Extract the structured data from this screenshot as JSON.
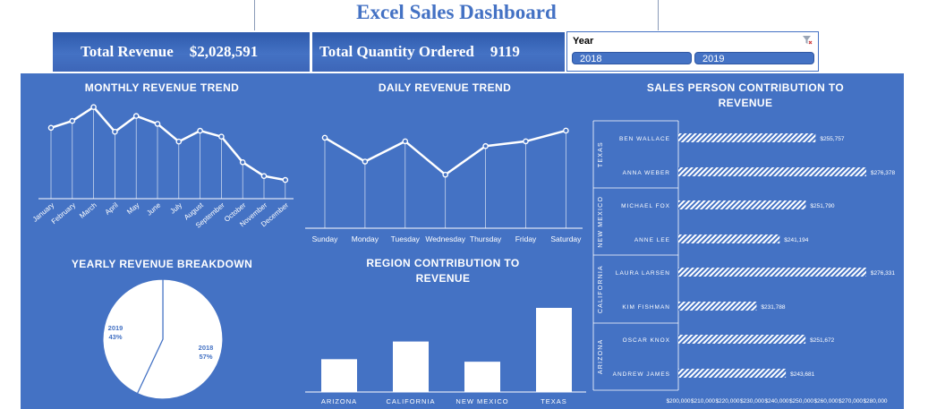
{
  "dashboard": {
    "title": "Excel Sales Dashboard",
    "kpis": {
      "revenue_label": "Total Revenue",
      "revenue_value": "$2,028,591",
      "quantity_label": "Total Quantity Ordered",
      "quantity_value": "9119"
    },
    "slicer": {
      "title": "Year",
      "options": [
        "2018",
        "2019"
      ],
      "clear_icon": "filter-clear-icon"
    },
    "colors": {
      "panel": "#4472c4",
      "title": "#4472c4",
      "marks": "#ffffff"
    }
  },
  "chart_data": [
    {
      "type": "line",
      "title": "MONTHLY REVENUE TREND",
      "categories": [
        "January",
        "February",
        "March",
        "April",
        "May",
        "June",
        "July",
        "August",
        "September",
        "October",
        "November",
        "December"
      ],
      "values": [
        0.72,
        0.79,
        0.93,
        0.68,
        0.84,
        0.76,
        0.58,
        0.69,
        0.63,
        0.37,
        0.23,
        0.19
      ],
      "value_scale": "relative (no axis printed)",
      "markers": true,
      "drop_lines": true
    },
    {
      "type": "line",
      "title": "DAILY REVENUE TREND",
      "categories": [
        "Sunday",
        "Monday",
        "Tuesday",
        "Wednesday",
        "Thursday",
        "Friday",
        "Saturday"
      ],
      "values": [
        0.76,
        0.56,
        0.73,
        0.45,
        0.69,
        0.73,
        0.82
      ],
      "value_scale": "relative (no axis printed)",
      "markers": true,
      "drop_lines": true
    },
    {
      "type": "pie",
      "title": "YEARLY REVENUE BREAKDOWN",
      "slices": [
        {
          "label": "2018",
          "pct_label": "57%",
          "value": 57
        },
        {
          "label": "2019",
          "pct_label": "43%",
          "value": 43
        }
      ]
    },
    {
      "type": "bar",
      "title": "REGION CONTRIBUTION TO REVENUE",
      "categories": [
        "ARIZONA",
        "CALIFORNIA",
        "NEW MEXICO",
        "TEXAS"
      ],
      "values": [
        0.39,
        0.6,
        0.36,
        1.0
      ],
      "value_scale": "relative (no axis printed)"
    },
    {
      "type": "bar",
      "orientation": "horizontal",
      "title": "SALES PERSON CONTRIBUTION TO REVENUE",
      "groups": [
        "TEXAS",
        "NEW MEXICO",
        "CALIFORNIA",
        "ARIZONA"
      ],
      "rows": [
        {
          "group": "TEXAS",
          "name": "BEN WALLACE",
          "value": 255757,
          "label": "$255,757"
        },
        {
          "group": "TEXAS",
          "name": "ANNA WEBER",
          "value": 276378,
          "label": "$276,378"
        },
        {
          "group": "NEW MEXICO",
          "name": "MICHAEL FOX",
          "value": 251790,
          "label": "$251,790"
        },
        {
          "group": "NEW MEXICO",
          "name": "ANNE LEE",
          "value": 241194,
          "label": "$241,194"
        },
        {
          "group": "CALIFORNIA",
          "name": "LAURA LARSEN",
          "value": 276331,
          "label": "$276,331"
        },
        {
          "group": "CALIFORNIA",
          "name": "KIM FISHMAN",
          "value": 231788,
          "label": "$231,788"
        },
        {
          "group": "ARIZONA",
          "name": "OSCAR KNOX",
          "value": 251672,
          "label": "$251,672"
        },
        {
          "group": "ARIZONA",
          "name": "ANDREW JAMES",
          "value": 243681,
          "label": "$243,681"
        }
      ],
      "xlim": [
        200000,
        280000
      ],
      "xticks": [
        "$200,000",
        "$210,000",
        "$220,000",
        "$230,000",
        "$240,000",
        "$250,000",
        "$260,000",
        "$270,000",
        "$280,000"
      ],
      "fill": "hatched"
    }
  ]
}
